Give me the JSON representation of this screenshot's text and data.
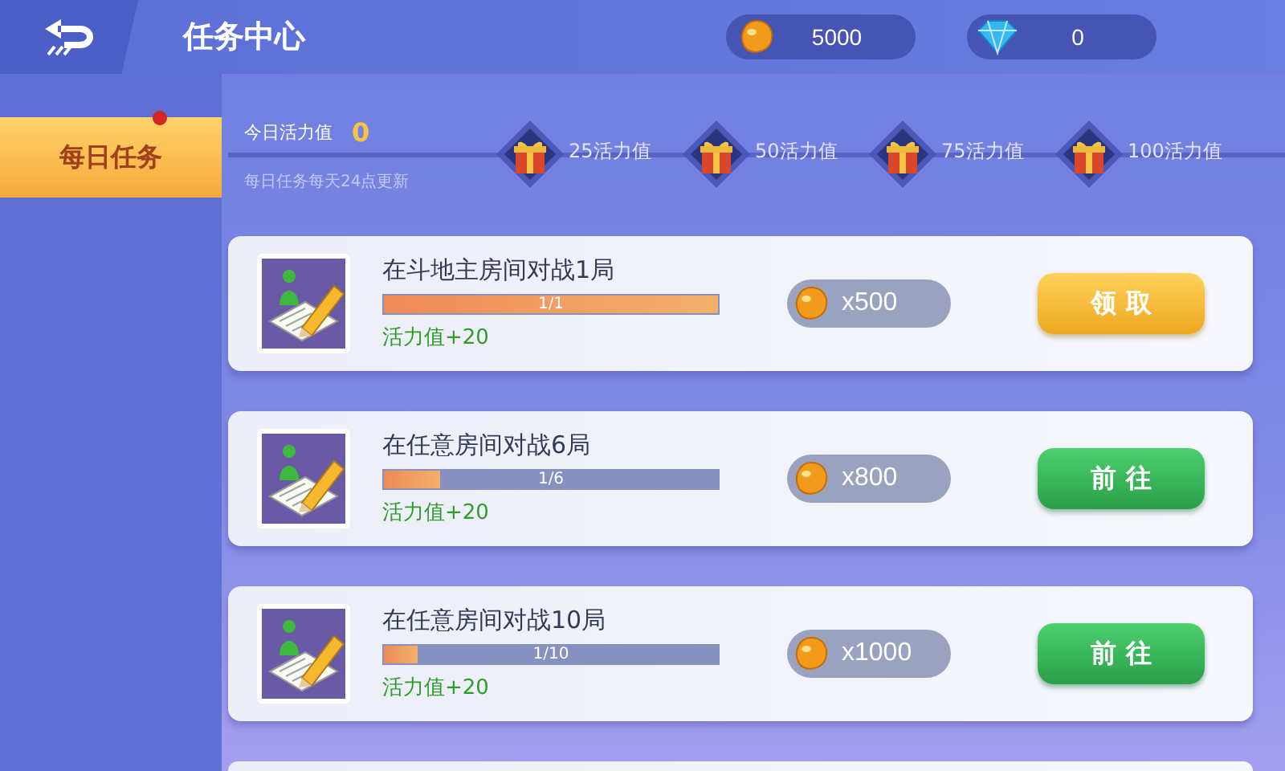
{
  "header": {
    "title": "任务中心"
  },
  "currencies": [
    {
      "kind": "bean",
      "amount": "5000"
    },
    {
      "kind": "diamond",
      "amount": "0"
    }
  ],
  "sidebar": {
    "items": [
      {
        "label": "每日任务",
        "selected": true,
        "notice": true
      }
    ]
  },
  "activity": {
    "label": "今日活力值",
    "value": "0",
    "note": "每日任务每天24点更新",
    "milestones": [
      {
        "label": "25活力值"
      },
      {
        "label": "50活力值"
      },
      {
        "label": "75活力值"
      },
      {
        "label": "100活力值"
      }
    ]
  },
  "tasks": [
    {
      "title": "在斗地主房间对战1局",
      "level": 1,
      "progress": "1/1",
      "bonus": "活力值+20",
      "reward": "x500",
      "button": {
        "kind": "claim",
        "label": "领 取"
      }
    },
    {
      "title": "在任意房间对战6局",
      "level": 0.167,
      "progress": "1/6",
      "bonus": "活力值+20",
      "reward": "x800",
      "button": {
        "kind": "go",
        "label": "前 往"
      }
    },
    {
      "title": "在任意房间对战10局",
      "level": 0.1,
      "progress": "1/10",
      "bonus": "活力值+20",
      "reward": "x1000",
      "button": {
        "kind": "go",
        "label": "前 往"
      }
    }
  ],
  "more_tasks_below": true
}
